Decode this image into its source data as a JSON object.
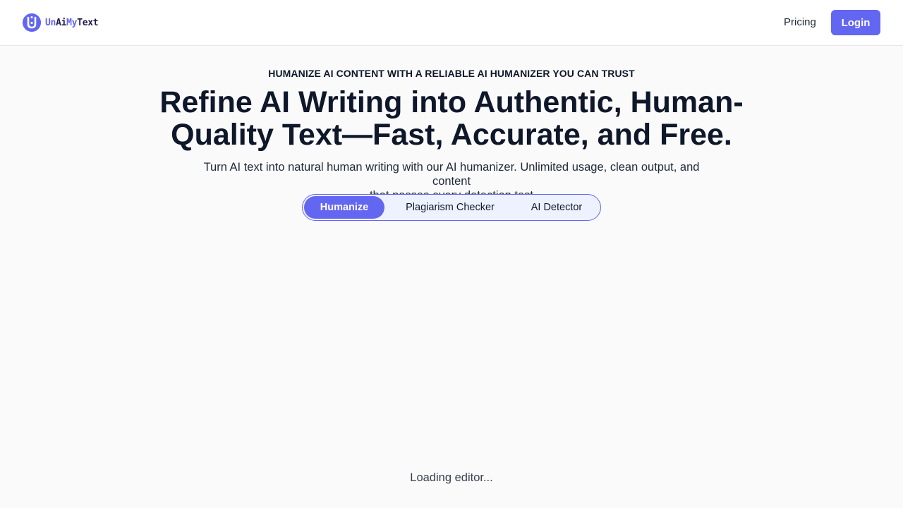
{
  "header": {
    "logo": {
      "part1": "Un",
      "part2": "Ai",
      "part3": "My",
      "part4": "Text",
      "icon": "logo-icon"
    },
    "nav": {
      "pricing_label": "Pricing",
      "login_label": "Login"
    }
  },
  "hero": {
    "eyebrow": "HUMANIZE AI CONTENT WITH A RELIABLE AI HUMANIZER YOU CAN TRUST",
    "title_line1": "Refine AI Writing into Authentic, Human-",
    "title_line2": "Quality Text—Fast, Accurate, and Free.",
    "subtitle_line1": "Turn AI text into natural human writing with our AI humanizer. Unlimited usage, clean output, and content",
    "subtitle_line2": "that passes every detection test"
  },
  "tabs": [
    {
      "label": "Humanize",
      "active": true
    },
    {
      "label": "Plagiarism Checker",
      "active": false
    },
    {
      "label": "AI Detector",
      "active": false
    }
  ],
  "editor": {
    "loading_text": "Loading editor..."
  },
  "colors": {
    "accent": "#6366f1",
    "text": "#0f172a",
    "background": "#fafafa",
    "tab_bg": "#eef2ff"
  }
}
